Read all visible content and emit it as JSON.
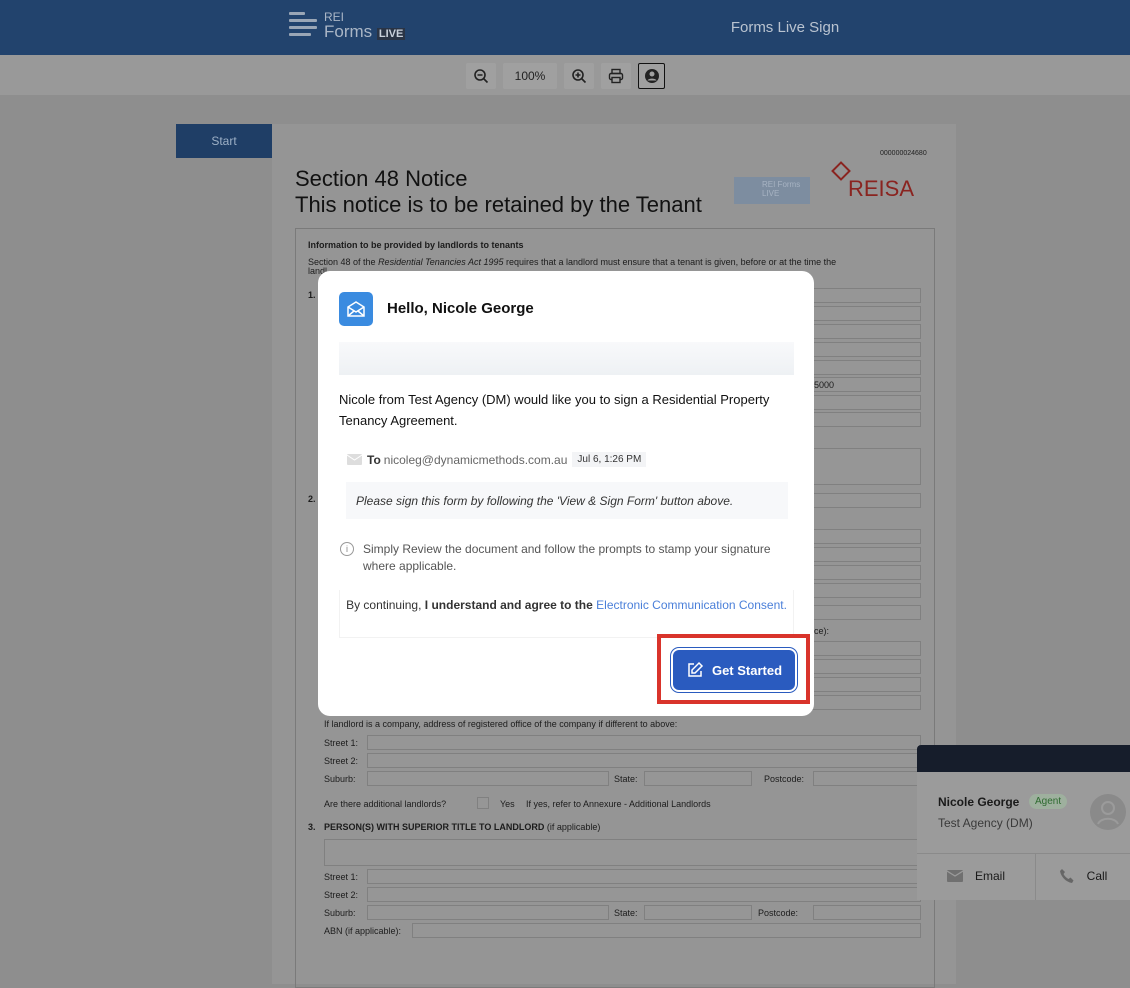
{
  "header": {
    "logo_top": "REI",
    "logo_main": "Forms",
    "logo_live": "LIVE",
    "title": "Forms Live Sign"
  },
  "toolbar": {
    "zoom_out_icon": "zoom-out-icon",
    "zoom_level": "100%",
    "zoom_in_icon": "zoom-in-icon",
    "print_icon": "print-icon",
    "profile_icon": "user-circle-icon"
  },
  "nav": {
    "start_label": "Start"
  },
  "document": {
    "doc_number": "000000024680",
    "title_line1": "Section 48 Notice",
    "title_line2": "This notice is to be retained by the Tenant",
    "logo_small": "REI Forms LIVE",
    "brand": "REISA",
    "info_heading": "Information to be provided by landlords to tenants",
    "intro_pre": "Section 48 of the ",
    "intro_act": "Residential Tenancies Act 1995",
    "intro_post": " requires that a landlord must ensure that a tenant is given, before or at the time the",
    "intro_line2": "landl",
    "sec1_num": "1.",
    "sec2_num": "2.",
    "postcode_value": "5000",
    "partial_label": "ce):",
    "company_label": "If landlord is a company, address of registered office of the company if different to above:",
    "street1": "Street 1:",
    "street2": "Street 2:",
    "suburb": "Suburb:",
    "state": "State:",
    "postcode": "Postcode:",
    "additional_q": "Are there additional landlords?",
    "yes": "Yes",
    "annexure": "If yes, refer to Annexure - Additional Landlords",
    "sec3_num": "3.",
    "sec3_title": "PERSON(S) WITH SUPERIOR TITLE TO LANDLORD",
    "sec3_suffix": " (if applicable)",
    "abn": "ABN (if applicable):"
  },
  "modal": {
    "greeting": "Hello, Nicole George",
    "message": "Nicole from Test Agency (DM) would like you to sign a Residential Property Tenancy Agreement.",
    "to_label": "To",
    "to_email": "nicoleg@dynamicmethods.com.au",
    "date": "Jul 6, 1:26 PM",
    "note": "Please sign this form by following the 'View & Sign Form' button above.",
    "info": "Simply Review the document and follow the prompts to stamp your signature where applicable.",
    "consent_pre": "By continuing, ",
    "consent_bold": "I understand and agree to the",
    "consent_link": "Electronic Communication Consent.",
    "button": "Get Started"
  },
  "agent_card": {
    "name": "Nicole George",
    "badge": "Agent",
    "agency": "Test Agency (DM)",
    "email_label": "Email",
    "call_label": "Call"
  },
  "colors": {
    "header": "#22436d",
    "button": "#2a5bbf",
    "highlight": "#d9342b",
    "link": "#4a7fd9",
    "badge": "#2e7d32"
  }
}
